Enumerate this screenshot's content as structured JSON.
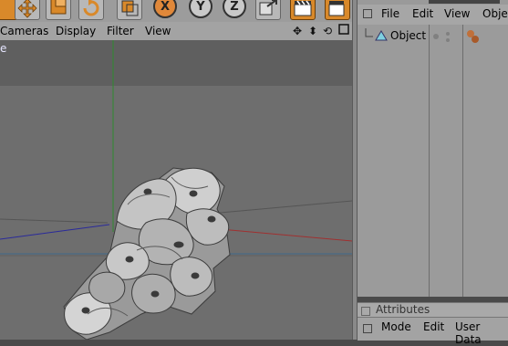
{
  "toolbar": {
    "axis_x": "X",
    "axis_y": "Y",
    "axis_z": "Z"
  },
  "viewport": {
    "menu": [
      "Cameras",
      "Display",
      "Filter",
      "View"
    ],
    "label": "e"
  },
  "object_manager": {
    "menu": [
      "File",
      "Edit",
      "View",
      "Obje"
    ],
    "object_name": "Object"
  },
  "attributes": {
    "title": "Attributes",
    "menu": [
      "Mode",
      "Edit",
      "User Data"
    ]
  },
  "colors": {
    "accent_orange": "#d9892a",
    "viewport_bg": "#6e6e6e",
    "panel_bg": "#9b9b9b",
    "axis_green": "#2e8b2e",
    "axis_red": "#a03030",
    "axis_blue": "#2a2a9a"
  }
}
